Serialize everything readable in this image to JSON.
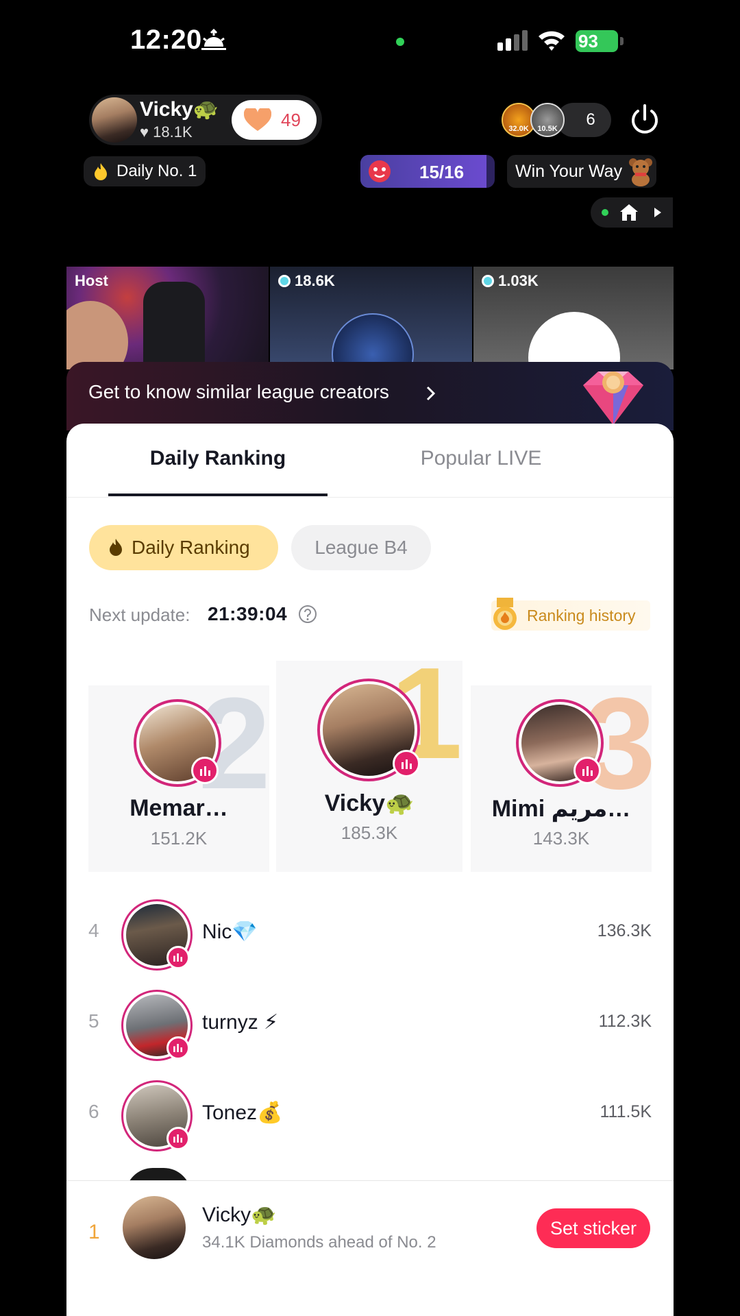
{
  "status_bar": {
    "time": "12:20",
    "battery": "93"
  },
  "live_header": {
    "host_name": "Vicky🐢",
    "host_likes": "♥ 18.1K",
    "follow_count": "49",
    "viewer_1": "32.0K",
    "viewer_2": "10.5K",
    "viewer_count": "6",
    "daily_badge": "Daily No. 1",
    "progress_text": "15/16",
    "progress_value": 0.9375,
    "promo_text": "Win Your Way"
  },
  "video_tiles": {
    "host_label": "Host",
    "tile2_count": "18.6K",
    "tile3_count": "1.03K"
  },
  "banner": {
    "text": "Get to know similar league creators"
  },
  "tabs": {
    "daily": "Daily Ranking",
    "popular": "Popular LIVE"
  },
  "filters": {
    "daily": "Daily Ranking",
    "league": "League B4"
  },
  "update": {
    "label": "Next update:",
    "time": "21:39:04",
    "history": "Ranking history"
  },
  "podium": {
    "first": {
      "rank": "1",
      "name": "Vicky🐢",
      "score": "185.3K"
    },
    "second": {
      "rank": "2",
      "name": "Memar…",
      "score": "151.2K"
    },
    "third": {
      "rank": "3",
      "name": "Mimi مريم…",
      "score": "143.3K"
    }
  },
  "list": [
    {
      "rank": "4",
      "name": "Nic💎",
      "score": "136.3K"
    },
    {
      "rank": "5",
      "name": "turnyz ⚡",
      "score": "112.3K"
    },
    {
      "rank": "6",
      "name": "Tonez💰",
      "score": "111.5K"
    }
  ],
  "self": {
    "rank": "1",
    "name": "Vicky🐢",
    "subtitle": "34.1K Diamonds ahead of No. 2",
    "button": "Set sticker"
  },
  "colors": {
    "accent": "#fe2c55",
    "live_ring": "#d2267a",
    "chip_daily": "#ffe39c"
  }
}
